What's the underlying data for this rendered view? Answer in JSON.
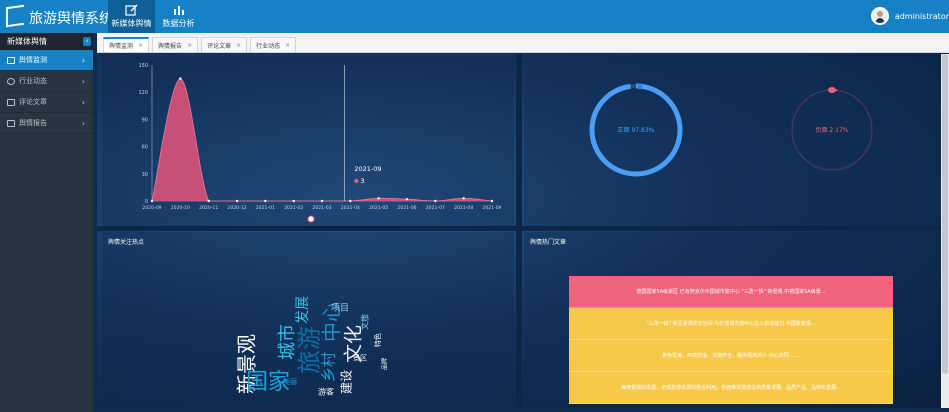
{
  "app": {
    "title": "旅游舆情系统"
  },
  "topnav": [
    {
      "label": "新媒体舆情",
      "icon": "edit-icon",
      "active": true
    },
    {
      "label": "数据分析",
      "icon": "bar-chart-icon",
      "active": false
    }
  ],
  "user": {
    "name": "administrator"
  },
  "sidebar": {
    "header": "新媒体舆情",
    "items": [
      {
        "label": "舆情监测",
        "icon": "monitor-icon",
        "active": true
      },
      {
        "label": "行业动态",
        "icon": "globe-icon",
        "active": false
      },
      {
        "label": "评论文章",
        "icon": "comment-icon",
        "active": false
      },
      {
        "label": "舆情报告",
        "icon": "report-icon",
        "active": false
      }
    ]
  },
  "tabs": [
    {
      "label": "舆情监测",
      "active": true
    },
    {
      "label": "舆情报告",
      "active": false
    },
    {
      "label": "评论文章",
      "active": false
    },
    {
      "label": "行业动态",
      "active": false
    }
  ],
  "chart_data": [
    {
      "type": "area",
      "x": [
        "2020-09",
        "2020-10",
        "2020-11",
        "2020-12",
        "2021-01",
        "2021-02",
        "2021-03",
        "2021-04",
        "2021-05",
        "2021-06",
        "2021-07",
        "2021-08",
        "2021-09"
      ],
      "values": [
        0,
        135,
        0,
        0,
        0,
        0,
        0,
        0,
        3,
        2,
        0,
        3,
        0
      ],
      "yticks": [
        0,
        30,
        60,
        90,
        120,
        150
      ],
      "ylim": [
        0,
        150
      ],
      "color": "#e8537a",
      "tooltip": {
        "label": "2021-09",
        "value": "3"
      }
    },
    {
      "type": "pie",
      "slices": [
        {
          "name": "正面",
          "value": 97.83,
          "label": "正面 97.83%",
          "color": "#4a9ff5"
        },
        {
          "name": "负面",
          "value": 2.17,
          "label": "负面 2.17%",
          "color": "#f0637c"
        }
      ]
    }
  ],
  "panels": {
    "hotspot_title": "舆情关注热点",
    "articles_title": "舆情热门文章"
  },
  "wordcloud": [
    {
      "text": "新景观",
      "color": "#ffffff"
    },
    {
      "text": "国家",
      "color": "#1aa3d8"
    },
    {
      "text": "城市",
      "color": "#2ec4e8"
    },
    {
      "text": "旅游",
      "color": "#0b6ea8"
    },
    {
      "text": "中心",
      "color": "#1f8fd0"
    },
    {
      "text": "文化",
      "color": "#e8eef5"
    },
    {
      "text": "乡村",
      "color": "#1aa3d8"
    },
    {
      "text": "建设",
      "color": "#ffffff"
    },
    {
      "text": "文旅",
      "color": "#8fd3f0"
    },
    {
      "text": "景区",
      "color": "#ffffff"
    },
    {
      "text": "发展",
      "color": "#2ec4e8"
    },
    {
      "text": "特色",
      "color": "#ffffff"
    },
    {
      "text": "项目",
      "color": "#8fd3f0"
    },
    {
      "text": "品牌",
      "color": "#ffffff"
    },
    {
      "text": "美丽",
      "color": "#1aa3d8"
    },
    {
      "text": "游客",
      "color": "#ffffff"
    }
  ],
  "articles": [
    {
      "text": "德国国家5A级景区 已有阿克尔中国城市建中心 \"三改一拆\" 新景观 中德国家5A级景...",
      "color": "pink"
    },
    {
      "text": "\"三改一拆\" 新区景观优化空间 为打造城市建中心注入新动能力 中国新景观...",
      "color": "yellow"
    },
    {
      "text": "景色优美、环境舒适、设施齐全、服务周到的小 中心共同 ......",
      "color": "yellow"
    },
    {
      "text": "美丽景观的发展，全域旅游资源的整合利用，全面推进旅游业高质量发展、品质产品、品牌化发展...",
      "color": "yellow"
    }
  ]
}
